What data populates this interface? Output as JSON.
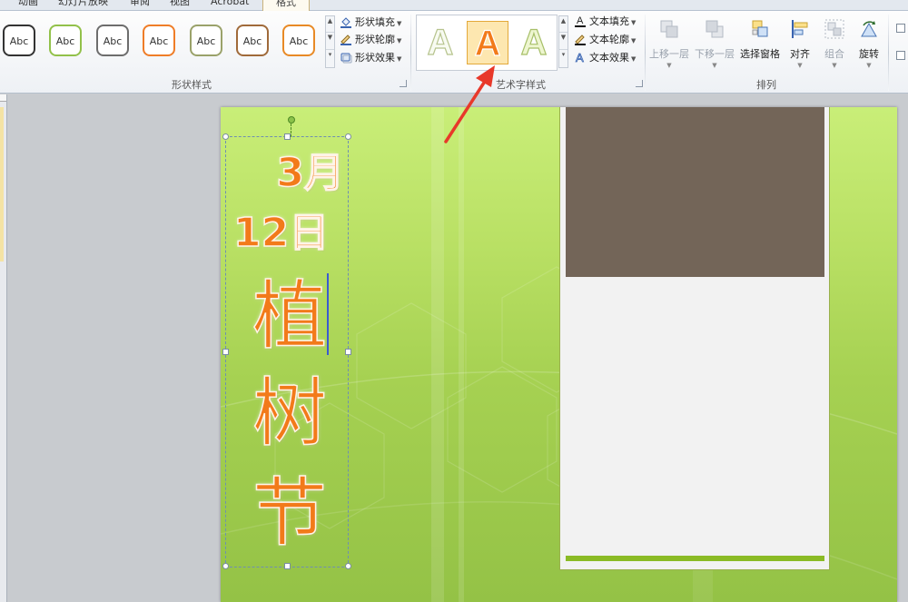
{
  "tabs": {
    "animation": "动画",
    "slideshow": "幻灯片放映",
    "review": "审阅",
    "view": "视图",
    "acrobat": "Acrobat",
    "format": "格式"
  },
  "ribbon": {
    "shape_styles": {
      "label": "形状样式",
      "thumb_text": "Abc",
      "thumb_borders": [
        "#333333",
        "#92c14a",
        "#6d6d6d",
        "#ef7d28",
        "#9aa26a",
        "#a06a3a",
        "#e88a26"
      ],
      "fill": "形状填充",
      "outline": "形状轮廓",
      "effects": "形状效果"
    },
    "wordart_styles": {
      "label": "艺术字样式",
      "glyph": "A",
      "fill": "文本填充",
      "outline": "文本轮廓",
      "effects": "文本效果"
    },
    "arrange": {
      "label": "排列",
      "bring_forward": "上移一层",
      "send_backward": "下移一层",
      "selection_pane": "选择窗格",
      "align": "对齐",
      "group": "组合",
      "rotate": "旋转"
    }
  },
  "slide": {
    "date_line1": "3月",
    "date_line2": "12日",
    "title_chars": [
      "植",
      "树",
      "节"
    ]
  },
  "colors": {
    "wordart_orange": "#f27a1a",
    "slide_green": "#b9e064",
    "photo_brown": "#736558",
    "accent_bar": "#8bbb25",
    "arrow_red": "#e8382a"
  }
}
